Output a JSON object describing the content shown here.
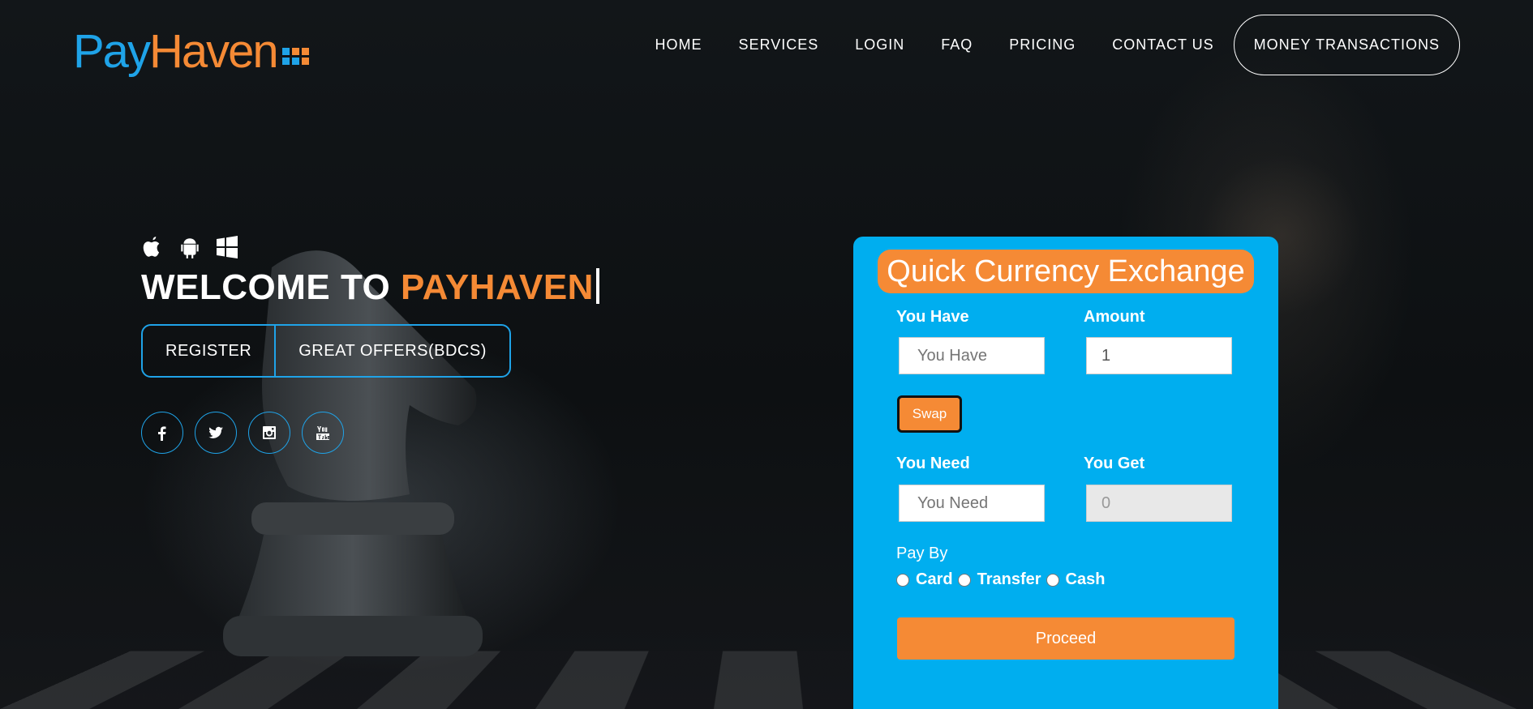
{
  "brand": {
    "pay": "Pay",
    "haven": "Haven"
  },
  "nav": {
    "items": [
      "HOME",
      "SERVICES",
      "LOGIN",
      "FAQ",
      "PRICING",
      "CONTACT US"
    ],
    "cta": "MONEY TRANSACTIONS"
  },
  "hero": {
    "os_icons": [
      "apple-icon",
      "android-icon",
      "windows-icon"
    ],
    "welcome_prefix": "WELCOME TO ",
    "welcome_accent": "PAYHAVEN",
    "buttons": [
      "REGISTER",
      "GREAT OFFERS(BDCS)"
    ],
    "socials": [
      "facebook-icon",
      "twitter-icon",
      "instagram-icon",
      "youtube-icon"
    ]
  },
  "exchange": {
    "title": "Quick Currency Exchange",
    "you_have_label": "You Have",
    "you_have_placeholder": "You Have",
    "amount_label": "Amount",
    "amount_value": "1",
    "swap_label": "Swap",
    "you_need_label": "You Need",
    "you_need_placeholder": "You Need",
    "you_get_label": "You Get",
    "you_get_value": "0",
    "pay_by_label": "Pay By",
    "pay_options": [
      "Card",
      "Transfer",
      "Cash"
    ],
    "proceed_label": "Proceed"
  },
  "colors": {
    "accent": "#f58a35",
    "brand_blue": "#1fa3e8",
    "panel": "#00aeef"
  }
}
